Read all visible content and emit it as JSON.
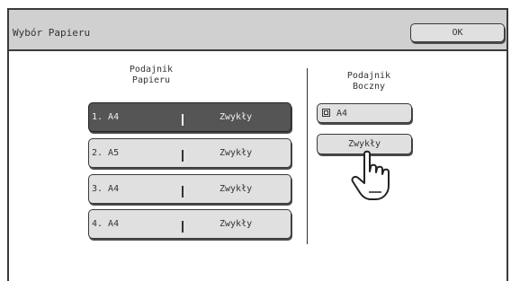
{
  "header": {
    "title": "Wybór Papieru",
    "ok_label": "OK"
  },
  "trays": {
    "heading": "Podajnik\nPapieru",
    "items": [
      {
        "label": "1. A4",
        "type": "Zwykły",
        "selected": true
      },
      {
        "label": "2. A5",
        "type": "Zwykły",
        "selected": false
      },
      {
        "label": "3. A4",
        "type": "Zwykły",
        "selected": false
      },
      {
        "label": "4. A4",
        "type": "Zwykły",
        "selected": false
      }
    ]
  },
  "bypass": {
    "heading": "Podajnik\nBoczny",
    "size_label": "A4",
    "type_label": "Zwykły"
  },
  "icons": {
    "tray": "paper-tray-icon",
    "bypass": "bypass-tray-icon",
    "pointer": "pointing-hand-icon"
  }
}
